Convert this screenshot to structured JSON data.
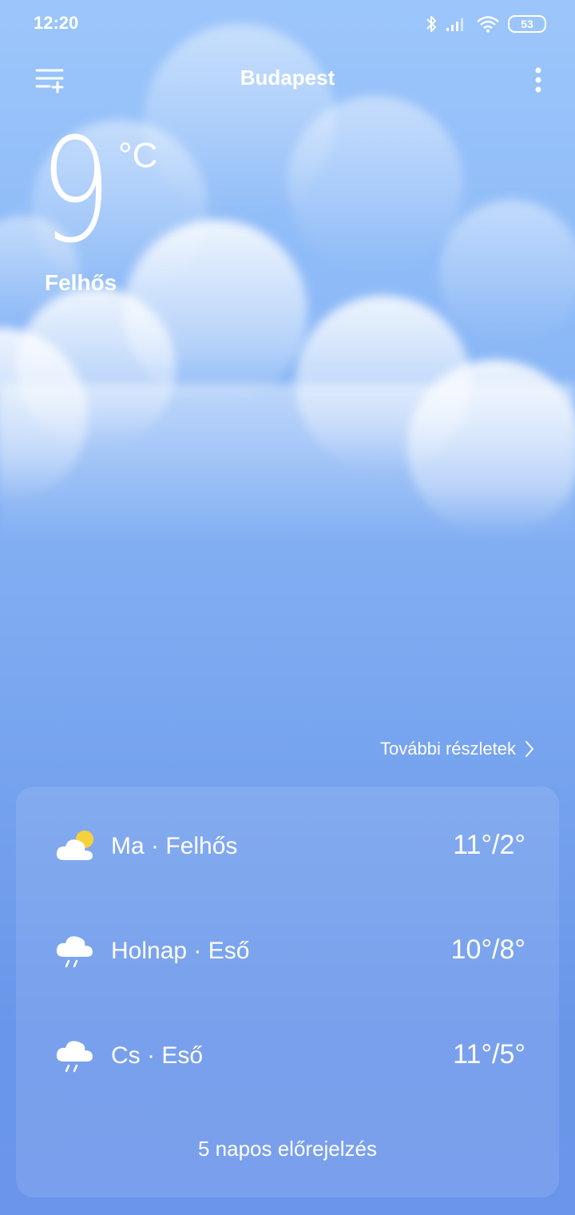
{
  "status": {
    "time": "12:20",
    "battery": "53"
  },
  "header": {
    "city": "Budapest"
  },
  "current": {
    "temperature": "9",
    "unit": "°C",
    "condition": "Felhős"
  },
  "details_link": "További részletek",
  "forecast": {
    "days": [
      {
        "label": "Ma · Felhős",
        "range": "11°/2°",
        "icon": "partly-cloudy-icon"
      },
      {
        "label": "Holnap · Eső",
        "range": "10°/8°",
        "icon": "rain-cloud-icon"
      },
      {
        "label": "Cs · Eső",
        "range": "11°/5°",
        "icon": "rain-cloud-icon"
      }
    ],
    "five_day_label": "5 napos előrejelzés"
  }
}
